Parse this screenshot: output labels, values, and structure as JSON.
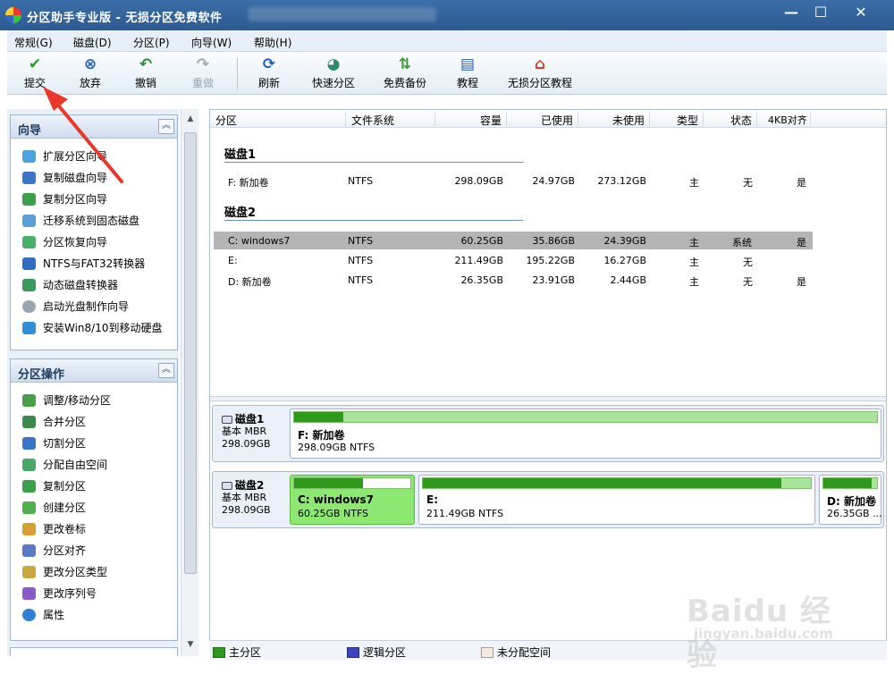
{
  "window": {
    "title": "分区助手专业版 - 无损分区免费软件",
    "controls": [
      "—",
      "☐",
      "✕"
    ]
  },
  "menu": [
    "常规(G)",
    "磁盘(D)",
    "分区(P)",
    "向导(W)",
    "帮助(H)"
  ],
  "toolbar": {
    "commit": "提交",
    "discard": "放弃",
    "undo": "撤销",
    "redo": "重做",
    "refresh": "刷新",
    "quick_partition": "快速分区",
    "free_backup": "免费备份",
    "tutorial": "教程",
    "lossless_tutorial": "无损分区教程"
  },
  "sidebar": {
    "wizards": {
      "title": "向导",
      "items": [
        "扩展分区向导",
        "复制磁盘向导",
        "复制分区向导",
        "迁移系统到固态磁盘",
        "分区恢复向导",
        "NTFS与FAT32转换器",
        "动态磁盘转换器",
        "启动光盘制作向导",
        "安装Win8/10到移动硬盘"
      ]
    },
    "operations": {
      "title": "分区操作",
      "items": [
        "调整/移动分区",
        "合并分区",
        "切割分区",
        "分配自由空间",
        "复制分区",
        "创建分区",
        "更改卷标",
        "分区对齐",
        "更改分区类型",
        "更改序列号",
        "属性"
      ]
    }
  },
  "table": {
    "columns": [
      "分区",
      "文件系统",
      "容量",
      "已使用",
      "未使用",
      "类型",
      "状态",
      "4KB对齐"
    ],
    "disks": [
      {
        "title": "磁盘1",
        "rows": [
          {
            "name": "F: 新加卷",
            "fs": "NTFS",
            "capacity": "298.09GB",
            "used": "24.97GB",
            "free": "273.12GB",
            "type": "主",
            "status": "无",
            "align": "是"
          }
        ]
      },
      {
        "title": "磁盘2",
        "rows": [
          {
            "name": "C: windows7",
            "fs": "NTFS",
            "capacity": "60.25GB",
            "used": "35.86GB",
            "free": "24.39GB",
            "type": "主",
            "status": "系统",
            "align": "是"
          },
          {
            "name": "E:",
            "fs": "NTFS",
            "capacity": "211.49GB",
            "used": "195.22GB",
            "free": "16.27GB",
            "type": "主",
            "status": "无",
            "align": ""
          },
          {
            "name": "D: 新加卷",
            "fs": "NTFS",
            "capacity": "26.35GB",
            "used": "23.91GB",
            "free": "2.44GB",
            "type": "主",
            "status": "无",
            "align": "是"
          }
        ]
      }
    ]
  },
  "disk_map": [
    {
      "name": "磁盘1",
      "kind": "基本 MBR",
      "size": "298.09GB",
      "partitions": [
        {
          "label": "F: 新加卷",
          "info": "298.09GB NTFS",
          "used_fraction": 0.084
        }
      ]
    },
    {
      "name": "磁盘2",
      "kind": "基本 MBR",
      "size": "298.09GB",
      "partitions": [
        {
          "label": "C: windows7",
          "info": "60.25GB NTFS",
          "used_fraction": 0.595
        },
        {
          "label": "E:",
          "info": "211.49GB NTFS",
          "used_fraction": 0.923
        },
        {
          "label": "D: 新加卷",
          "info": "26.35GB ...",
          "used_fraction": 0.907
        }
      ]
    }
  ],
  "legend": [
    "主分区",
    "逻辑分区",
    "未分配空间"
  ],
  "colors": {
    "primary_partition": "#2d9a1c",
    "logical_partition": "#3b44b8",
    "unallocated": "#f3ece0",
    "selected_row": "#b4b4b4",
    "annotation_arrow": "#e8382c"
  },
  "watermark": {
    "brand": "Baidu 经验",
    "url": "jingyan.baidu.com"
  }
}
